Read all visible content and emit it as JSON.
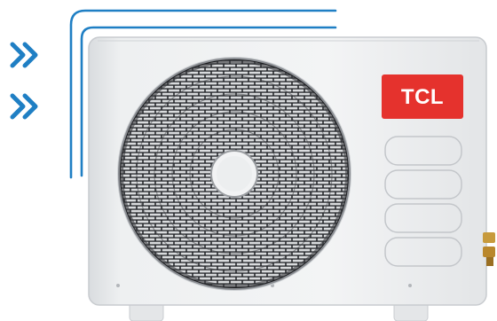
{
  "product": {
    "brand_label": "TCL",
    "brand_color": "#e5322d",
    "unit_color": "#eceeef",
    "airflow_color": "#1f7fc4"
  }
}
